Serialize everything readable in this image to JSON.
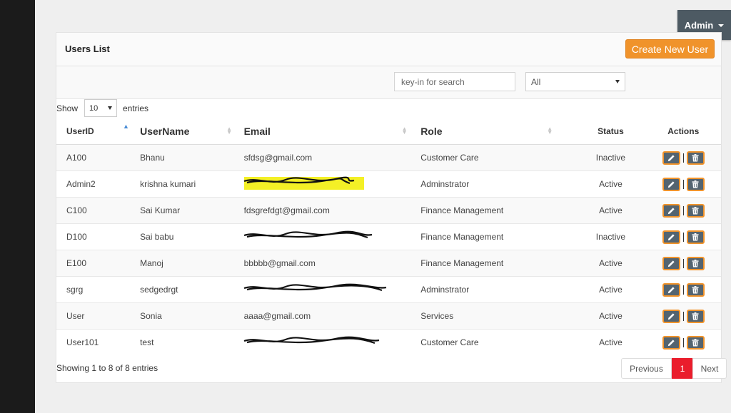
{
  "header": {
    "admin_label": "Admin"
  },
  "panel": {
    "title": "Users List",
    "create_label": "Create New User"
  },
  "filters": {
    "search_placeholder": "key-in for search",
    "role_selected": "All"
  },
  "length": {
    "show_label": "Show",
    "value": "10",
    "entries_label": "entries"
  },
  "table": {
    "columns": [
      "UserID",
      "UserName",
      "Email",
      "Role",
      "Status",
      "Actions"
    ],
    "rows": [
      {
        "id": "A100",
        "name": "Bhanu",
        "email": "sfdsg@gmail.com",
        "role": "Customer Care",
        "status": "Inactive"
      },
      {
        "id": "Admin2",
        "name": "krishna kumari",
        "email": "",
        "role": "Adminstrator",
        "status": "Active"
      },
      {
        "id": "C100",
        "name": "Sai Kumar",
        "email": "fdsgrefdgt@gmail.com",
        "role": "Finance Management",
        "status": "Active"
      },
      {
        "id": "D100",
        "name": "Sai babu",
        "email": "",
        "role": "Finance Management",
        "status": "Inactive"
      },
      {
        "id": "E100",
        "name": "Manoj",
        "email": "bbbbb@gmail.com",
        "role": "Finance Management",
        "status": "Active"
      },
      {
        "id": "sgrg",
        "name": "sedgedrgt",
        "email": "",
        "role": "Adminstrator",
        "status": "Active"
      },
      {
        "id": "User",
        "name": "Sonia",
        "email": "aaaa@gmail.com",
        "role": "Services",
        "status": "Active"
      },
      {
        "id": "User101",
        "name": "test",
        "email": "",
        "role": "Customer Care",
        "status": "Active"
      }
    ]
  },
  "footer": {
    "info": "Showing 1 to 8 of 8 entries",
    "prev_label": "Previous",
    "current_page": "1",
    "next_label": "Next"
  },
  "colors": {
    "accent_orange": "#f0932b",
    "page_active": "#ea1d2c",
    "header_btn": "#4d5a63"
  },
  "icons": {
    "edit": "pencil-icon",
    "delete": "trash-icon",
    "sort": "sort-icon"
  }
}
